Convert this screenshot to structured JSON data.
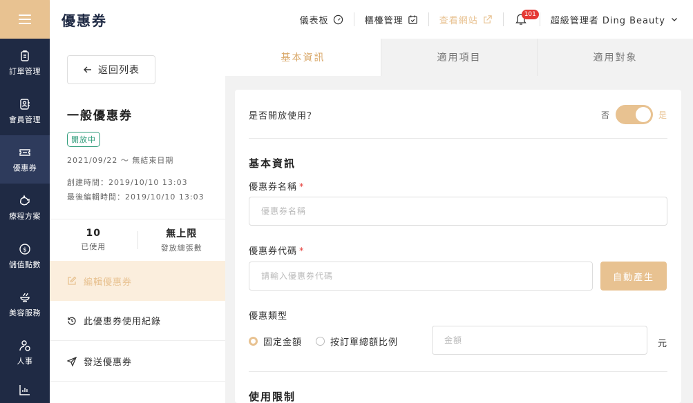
{
  "header": {
    "title": "優惠券",
    "links": {
      "dashboard": "儀表板",
      "counter": "櫃檯管理",
      "view_site": "查看網站"
    },
    "notification_count": "101",
    "user": "超級管理者 Ding Beauty"
  },
  "nav": {
    "items": [
      {
        "label": "訂單管理",
        "icon": "order-icon"
      },
      {
        "label": "會員管理",
        "icon": "member-icon"
      },
      {
        "label": "優惠券",
        "icon": "ticket-icon"
      },
      {
        "label": "療程方案",
        "icon": "piggy-icon"
      },
      {
        "label": "儲值點數",
        "icon": "dollar-icon"
      },
      {
        "label": "美容服務",
        "icon": "spa-icon"
      },
      {
        "label": "人事",
        "icon": "person-icon"
      }
    ],
    "active_index": 2
  },
  "side": {
    "back_label": "返回列表",
    "coupon_name": "一般優惠券",
    "status": "開放中",
    "period": "2021/09/22 ～ 無結束日期",
    "created": "創建時間：2019/10/10 13:03",
    "edited": "最後編輯時間：2019/10/10 13:03",
    "stats": [
      {
        "value": "10",
        "caption": "已使用"
      },
      {
        "value": "無上限",
        "caption": "發放總張數"
      }
    ],
    "menu": [
      {
        "label": "編輯優惠券"
      },
      {
        "label": "此優惠券使用紀錄"
      },
      {
        "label": "發送優惠券"
      }
    ]
  },
  "tabs": [
    {
      "label": "基本資訊"
    },
    {
      "label": "適用項目"
    },
    {
      "label": "適用對象"
    }
  ],
  "form": {
    "open_question": "是否開放使用？",
    "toggle_off": "否",
    "toggle_on": "是",
    "section_basic": "基本資訊",
    "name_label": "優惠券名稱",
    "required_mark": "*",
    "name_placeholder": "優惠券名稱",
    "code_label": "優惠券代碼",
    "code_placeholder": "請輸入優惠券代碼",
    "generate_label": "自動產生",
    "type_label": "優惠類型",
    "type_options": [
      "固定金額",
      "按訂單總額比例"
    ],
    "amount_placeholder": "金額",
    "unit": "元",
    "section_limit": "使用限制"
  },
  "colors": {
    "accent": "#e8c291",
    "nav_bg": "#1f2a44",
    "status_green": "#2e9c7a"
  }
}
